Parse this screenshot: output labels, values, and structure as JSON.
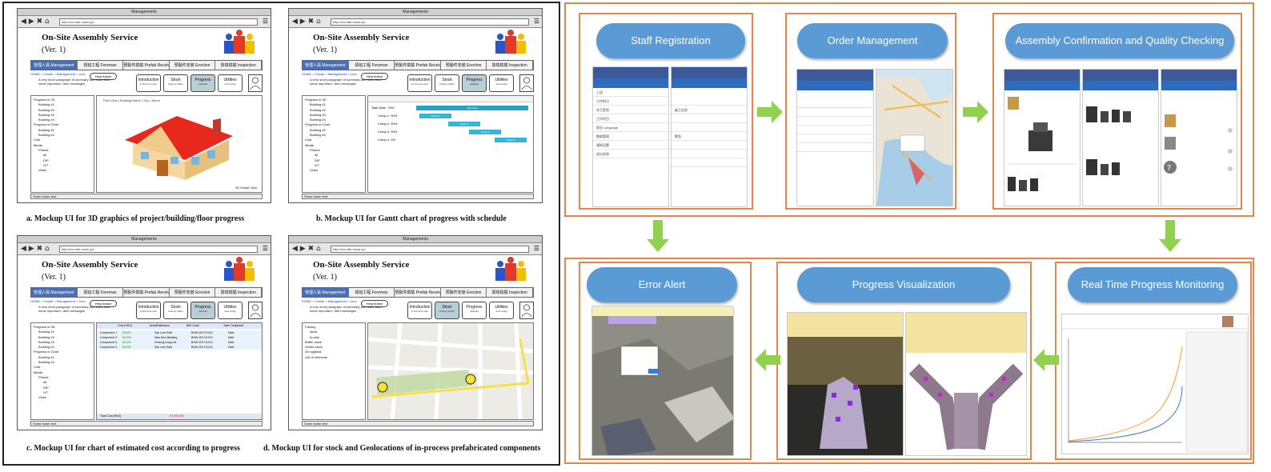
{
  "left": {
    "mockups": [
      {
        "id": "a",
        "window_title": "Managements",
        "url": "http://xxx.site.mock.up/",
        "app_title": "On-Site Assembly Service",
        "app_version": "(Ver. 1)",
        "tabs": [
          "管理人員 Management",
          "領班工程 Foreman",
          "預製件檢驗 Prefab Receive",
          "預製件安裝 Erection",
          "質檢檢驗 Inspection"
        ],
        "breadcrumb": "HOME > Onsite > Management > xxxx",
        "help": "Help button",
        "note": "A very short paragraph of summary with links. Also some important / alert messages",
        "buttons": [
          {
            "label": "Introduction",
            "sub": "to first time user"
          },
          {
            "label": "Stock",
            "sub": "Factory buffer"
          },
          {
            "label": "Progress",
            "sub": "(default)"
          },
          {
            "label": "Utilities",
            "sub": "and config"
          }
        ],
        "content_links": "Plan View | Building Name | Sun | Wires",
        "content_caption": "3D Model View",
        "status": "Some footer text"
      },
      {
        "id": "b",
        "window_title": "Managements",
        "url": "http://xxx.site.mock.up/",
        "app_title": "On-Site Assembly Service",
        "app_version": "(Ver. 1)",
        "status": "Some footer text",
        "gantt_rows": [
          {
            "name": "Task Main",
            "pct": "75%"
          },
          {
            "name": "Comp 1",
            "pct": "90%"
          },
          {
            "name": "Comp 2",
            "pct": "90%"
          },
          {
            "name": "Comp 3",
            "pct": "90%"
          },
          {
            "name": "Comp 4",
            "pct": "0%"
          }
        ],
        "gantt_labels": [
          "Task Main",
          "Comp 1",
          "Comp 2",
          "Comp 3",
          "Comp 4"
        ]
      },
      {
        "id": "c",
        "window_title": "Managements",
        "url": "http://xxx.site.mock.up/",
        "app_title": "On-Site Assembly Service",
        "app_version": "(Ver. 1)",
        "status": "Some footer text",
        "table_headers": [
          "Cost (HKD)",
          "Area/Buildname",
          "BIM Code",
          "Task Completed"
        ],
        "table_rows": [
          [
            "Component 1",
            "$3,000",
            "Sau Lam Estd",
            "BGW-201711212",
            "Date"
          ],
          [
            "Component 2",
            "$3,000",
            "Wan Mun Building",
            "BGW-201711212",
            "Date"
          ],
          [
            "Component 3",
            "$3,000",
            "Cheung Kong Ltd",
            "BGW-201711212",
            "Date"
          ],
          [
            "Component 4",
            "$3,000",
            "Sau Lam Estd",
            "BGW-201711212",
            "Date"
          ]
        ],
        "total_label": "Total Cost (HKD)",
        "total_value": "$7,000,000"
      },
      {
        "id": "d",
        "window_title": "Managements",
        "url": "http://xxx.site.mock.up/",
        "app_title": "On-Site Assembly Service",
        "app_version": "(Ver. 1)",
        "status": "Some footer text",
        "tree": [
          "Factory",
          "stock",
          "in-plan",
          "Buffer stock",
          "Onsite stock",
          "On logistics",
          "List of elements"
        ]
      }
    ],
    "captions": {
      "a": "a. Mockup UI for 3D graphics of project/building/floor progress",
      "b": "b. Mockup UI for Gantt chart of progress with schedule",
      "c": "c. Mockup UI for chart of estimated cost according to progress",
      "d": "d. Mockup UI for stock and Geolocations of in-process prefabricated components"
    },
    "sidebar_items": [
      "Progress in 3D",
      "Building #1",
      "Building #2",
      "Building #3",
      "Building #4",
      "Progress in Chart",
      "Building #1",
      "Building #4",
      "Cost",
      "Media",
      "Photos",
      "all",
      "DIP",
      "IVT",
      "Video"
    ]
  },
  "right": {
    "steps": {
      "staff": "Staff Registration",
      "order": "Order Management",
      "assembly": "Assembly Confirmation and Quality Checking",
      "error": "Error Alert",
      "progress": "Progress Visualization",
      "realtime": "Real Time Progress Monitoring"
    },
    "staff_rows": [
      "上班",
      "工作地点",
      "本月签到",
      "工作项目",
      "报告 Language",
      "数据管理",
      "通知设置",
      "退出系统"
    ],
    "order_sections": [
      "員工信息",
      "緊急"
    ],
    "accent": "#5b9bd5",
    "frame": "#e8834a",
    "arrow": "#92d050"
  }
}
